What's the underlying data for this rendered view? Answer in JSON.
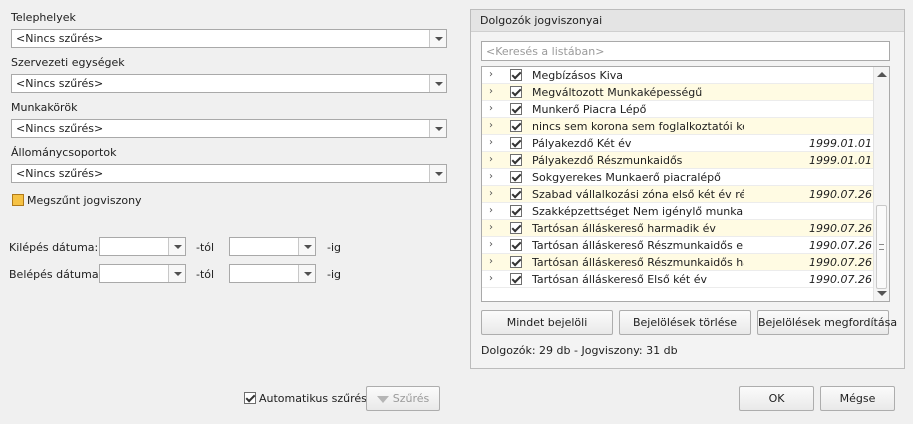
{
  "filters": {
    "telephelyek_label": "Telephelyek",
    "telephelyek_value": "<Nincs szűrés>",
    "szervezeti_label": "Szervezeti egységek",
    "szervezeti_value": "<Nincs szűrés>",
    "munkakorok_label": "Munkakörök",
    "munkakorok_value": "<Nincs szűrés>",
    "allomany_label": "Állománycsoportok",
    "allomany_value": "<Nincs szűrés>",
    "megszunt_label": "Megszűnt jogviszony",
    "kilepes_label": "Kilépés dátuma:",
    "belepes_label": "Belépés dátuma:",
    "tol": "-tól",
    "ig": "-ig"
  },
  "panel": {
    "title": "Dolgozók jogviszonyai",
    "search_placeholder": "<Keresés a listában>",
    "rows": [
      {
        "name": "Megbízásos  Kiva",
        "date": ""
      },
      {
        "name": "Megváltozott  Munkaképességű",
        "date": ""
      },
      {
        "name": "Munkerő  Piacra Lépő",
        "date": ""
      },
      {
        "name": "nincs sem korona  sem foglalkoztatói kedvez",
        "date": ""
      },
      {
        "name": "Pályakezdő Két év",
        "date": "1999.01.01"
      },
      {
        "name": "Pályakezdő Részmunkaidős",
        "date": "1999.01.01"
      },
      {
        "name": "Sokgyerekes  Munkaerő piacralépő",
        "date": ""
      },
      {
        "name": "Szabad vállalkozási zóna első két év részmur",
        "date": "1990.07.26"
      },
      {
        "name": "Szakképzettséget  Nem igénylő munkakör",
        "date": ""
      },
      {
        "name": "Tartósan álláskereső harmadik év",
        "date": "1990.07.26"
      },
      {
        "name": "Tartósan álláskereső Részmunkaidős első ké",
        "date": "1990.07.26"
      },
      {
        "name": "Tartósan álláskereső Részmunkaidős harmac",
        "date": "1990.07.26"
      },
      {
        "name": "Tartósan álláskereső Első két év",
        "date": "1990.07.26"
      }
    ],
    "btn_select_all": "Mindet bejelöli",
    "btn_clear": "Bejelölések törlése",
    "btn_invert": "Bejelölések megfordítása",
    "summary": "Dolgozók: 29 db - Jogviszony: 31 db"
  },
  "footer": {
    "auto_filter": "Automatikus szűrés",
    "filter_btn": "Szűrés",
    "ok": "OK",
    "cancel": "Mégse"
  }
}
